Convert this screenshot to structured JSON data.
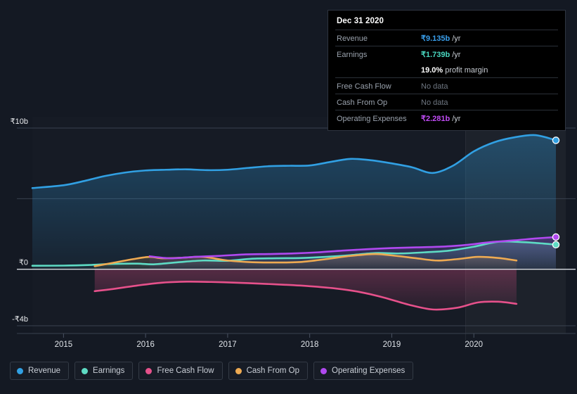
{
  "chart_data": {
    "type": "area",
    "title": "",
    "xlabel": "",
    "ylabel": "",
    "currency_symbol": "₹",
    "x_tick_labels": [
      "2015",
      "2016",
      "2017",
      "2018",
      "2019",
      "2020"
    ],
    "x_tick_values": [
      2015,
      2016,
      2017,
      2018,
      2019,
      2020
    ],
    "y_tick_labels": [
      "₹10b",
      "₹0",
      "-₹4b"
    ],
    "y_tick_values": [
      10,
      0,
      -4
    ],
    "ylim": [
      -4.55,
      10.8
    ],
    "xlim": [
      2014.62,
      2021.12
    ],
    "unit": "billion INR",
    "grid": true,
    "gridline_values": [
      10,
      5,
      -4
    ],
    "zero_line_value": 0,
    "legend_position": "bottom",
    "forecast_band_start": 2019.9,
    "series": [
      {
        "name": "Revenue",
        "color": "#31a0e3",
        "fill_top": "rgba(49,160,227,0.34)",
        "fill_bottom": "rgba(49,160,227,0.06)",
        "end_marker": true,
        "x": [
          2014.62,
          2015.0,
          2015.25,
          2015.5,
          2015.75,
          2016.0,
          2016.25,
          2016.5,
          2016.75,
          2017.0,
          2017.25,
          2017.5,
          2017.75,
          2018.0,
          2018.25,
          2018.5,
          2018.75,
          2019.0,
          2019.25,
          2019.5,
          2019.75,
          2020.0,
          2020.25,
          2020.5,
          2020.75,
          2021.0
        ],
        "values": [
          5.75,
          5.95,
          6.25,
          6.6,
          6.85,
          7.0,
          7.05,
          7.08,
          7.02,
          7.05,
          7.18,
          7.3,
          7.33,
          7.35,
          7.6,
          7.82,
          7.72,
          7.5,
          7.22,
          6.82,
          7.35,
          8.35,
          9.0,
          9.35,
          9.5,
          9.135
        ]
      },
      {
        "name": "Earnings",
        "color": "#5edbc4",
        "fill_top": "rgba(94,219,196,0.26)",
        "fill_bottom": "rgba(94,219,196,0.05)",
        "end_marker": true,
        "x": [
          2014.62,
          2015.0,
          2015.3,
          2015.6,
          2015.9,
          2016.1,
          2016.4,
          2016.7,
          2017.0,
          2017.3,
          2017.6,
          2017.9,
          2018.2,
          2018.5,
          2018.8,
          2019.1,
          2019.4,
          2019.7,
          2020.0,
          2020.3,
          2020.6,
          2020.85,
          2021.0
        ],
        "values": [
          0.25,
          0.26,
          0.3,
          0.38,
          0.4,
          0.35,
          0.5,
          0.62,
          0.6,
          0.75,
          0.78,
          0.8,
          0.88,
          1.0,
          1.15,
          1.12,
          1.2,
          1.32,
          1.6,
          1.95,
          1.92,
          1.82,
          1.739
        ]
      },
      {
        "name": "Free Cash Flow",
        "color": "#e6518b",
        "fill_top": "rgba(230,81,139,0.30)",
        "fill_bottom": "rgba(230,81,139,0.07)",
        "end_marker": false,
        "x": [
          2015.38,
          2015.6,
          2015.9,
          2016.2,
          2016.5,
          2016.8,
          2017.1,
          2017.4,
          2017.7,
          2018.0,
          2018.3,
          2018.6,
          2018.9,
          2019.2,
          2019.5,
          2019.8,
          2020.05,
          2020.3,
          2020.52
        ],
        "values": [
          -1.55,
          -1.4,
          -1.15,
          -0.95,
          -0.88,
          -0.9,
          -0.95,
          -1.02,
          -1.1,
          -1.2,
          -1.35,
          -1.6,
          -2.0,
          -2.5,
          -2.85,
          -2.72,
          -2.35,
          -2.3,
          -2.45
        ]
      },
      {
        "name": "Cash From Op",
        "color": "#eeaa52",
        "fill_top": "rgba(238,170,82,0.22)",
        "fill_bottom": "rgba(238,170,82,0.05)",
        "end_marker": false,
        "x": [
          2015.38,
          2015.6,
          2015.85,
          2016.05,
          2016.2,
          2016.45,
          2016.7,
          2017.0,
          2017.3,
          2017.6,
          2017.9,
          2018.2,
          2018.5,
          2018.8,
          2019.05,
          2019.3,
          2019.55,
          2019.8,
          2020.05,
          2020.3,
          2020.52
        ],
        "values": [
          0.22,
          0.45,
          0.72,
          0.88,
          0.78,
          0.82,
          0.88,
          0.62,
          0.5,
          0.48,
          0.52,
          0.72,
          0.95,
          1.08,
          0.95,
          0.78,
          0.62,
          0.72,
          0.88,
          0.8,
          0.62
        ]
      },
      {
        "name": "Operating Expenses",
        "color": "#b049f0",
        "fill_top": "rgba(176,73,240,0.26)",
        "fill_bottom": "rgba(176,73,240,0.05)",
        "end_marker": true,
        "x": [
          2016.05,
          2016.3,
          2016.6,
          2016.9,
          2017.2,
          2017.5,
          2017.8,
          2018.1,
          2018.4,
          2018.7,
          2019.0,
          2019.3,
          2019.6,
          2019.9,
          2020.2,
          2020.5,
          2020.75,
          2021.0
        ],
        "values": [
          0.92,
          0.78,
          0.88,
          0.95,
          1.05,
          1.08,
          1.12,
          1.2,
          1.32,
          1.42,
          1.5,
          1.55,
          1.6,
          1.72,
          1.92,
          2.05,
          2.18,
          2.281
        ]
      }
    ]
  },
  "tooltip": {
    "date": "Dec 31 2020",
    "rows": [
      {
        "label": "Revenue",
        "value": "₹9.135b",
        "suffix": "/yr",
        "color": "#3aa0ee",
        "no_data": false
      },
      {
        "label": "Earnings",
        "value": "₹1.739b",
        "suffix": "/yr",
        "color": "#49d7c0",
        "no_data": false
      },
      {
        "label": "",
        "value": "19.0%",
        "suffix": "profit margin",
        "color": "#ffffff",
        "no_data": false,
        "is_margin": true
      },
      {
        "label": "Free Cash Flow",
        "value": "No data",
        "suffix": "",
        "color": "#6e7681",
        "no_data": true
      },
      {
        "label": "Cash From Op",
        "value": "No data",
        "suffix": "",
        "color": "#6e7681",
        "no_data": true
      },
      {
        "label": "Operating Expenses",
        "value": "₹2.281b",
        "suffix": "/yr",
        "color": "#c04cf5",
        "no_data": false
      }
    ]
  },
  "legend": {
    "items": [
      {
        "label": "Revenue",
        "color": "#31a0e3"
      },
      {
        "label": "Earnings",
        "color": "#5edbc4"
      },
      {
        "label": "Free Cash Flow",
        "color": "#e6518b"
      },
      {
        "label": "Cash From Op",
        "color": "#eeaa52"
      },
      {
        "label": "Operating Expenses",
        "color": "#b049f0"
      }
    ]
  },
  "theme": {
    "background": "#141923",
    "plot_background": "#131823",
    "gridline_color": "#39414f",
    "zero_line_color": "#d8dce2",
    "text_color": "#e8eaed"
  }
}
